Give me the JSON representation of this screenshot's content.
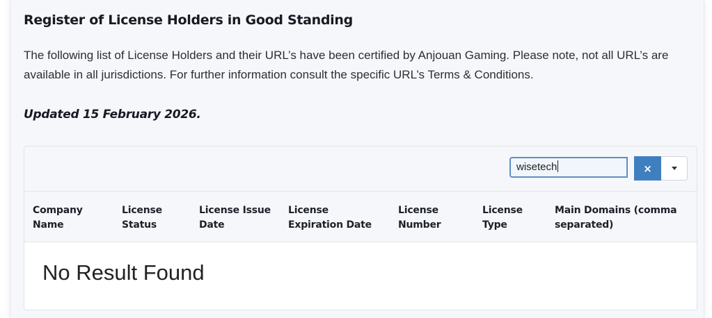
{
  "page": {
    "title": "Register of License Holders in Good Standing",
    "intro": "The following list of License Holders and their URL’s have been certified by Anjouan Gaming. Please note, not all URL’s are available in all jurisdictions. For further information consult the specific URL’s Terms & Conditions.",
    "updated": "Updated 15 February 2026."
  },
  "search": {
    "value": "wisetech",
    "clear_label": "×",
    "clear_icon": "close-icon",
    "dropdown_icon": "caret-down-icon"
  },
  "table": {
    "columns": [
      {
        "line1": "Company",
        "line2": "Name"
      },
      {
        "line1": "License",
        "line2": "Status"
      },
      {
        "line1": "License Issue",
        "line2": "Date"
      },
      {
        "line1": "License",
        "line2": "Expiration Date"
      },
      {
        "line1": "License",
        "line2": "Number"
      },
      {
        "line1": "License",
        "line2": "Type"
      },
      {
        "line1": "Main Domains (comma",
        "line2": "separated)"
      }
    ],
    "empty_message": "No Result Found"
  }
}
